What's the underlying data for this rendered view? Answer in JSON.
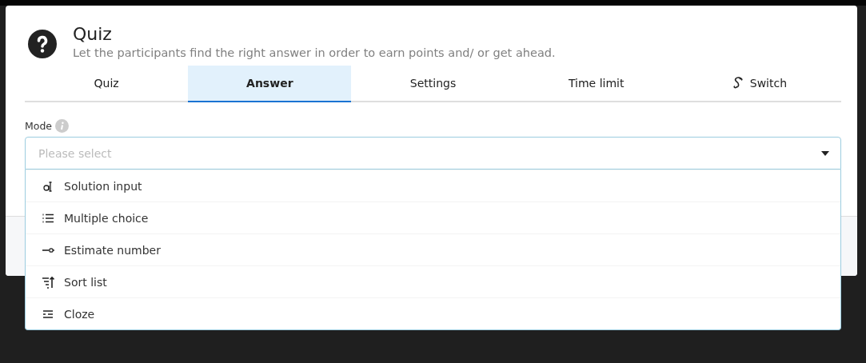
{
  "dialog": {
    "title": "Quiz",
    "subtitle": "Let the participants find the right answer in order to earn points and/ or get ahead."
  },
  "tabs": [
    {
      "label": "Quiz",
      "selected": false,
      "kind": "plain"
    },
    {
      "label": "Answer",
      "selected": true,
      "kind": "plain"
    },
    {
      "label": "Settings",
      "selected": false,
      "kind": "plain"
    },
    {
      "label": "Time limit",
      "selected": false,
      "kind": "plain"
    },
    {
      "label": "Switch",
      "selected": false,
      "kind": "link"
    }
  ],
  "mode_field": {
    "label": "Mode",
    "placeholder": "Please select",
    "expanded": true,
    "options": [
      {
        "label": "Solution input",
        "kind": "text"
      },
      {
        "label": "Multiple choice",
        "kind": "list"
      },
      {
        "label": "Estimate number",
        "kind": "slider"
      },
      {
        "label": "Sort list",
        "kind": "sort"
      },
      {
        "label": "Cloze",
        "kind": "cloze"
      }
    ]
  }
}
